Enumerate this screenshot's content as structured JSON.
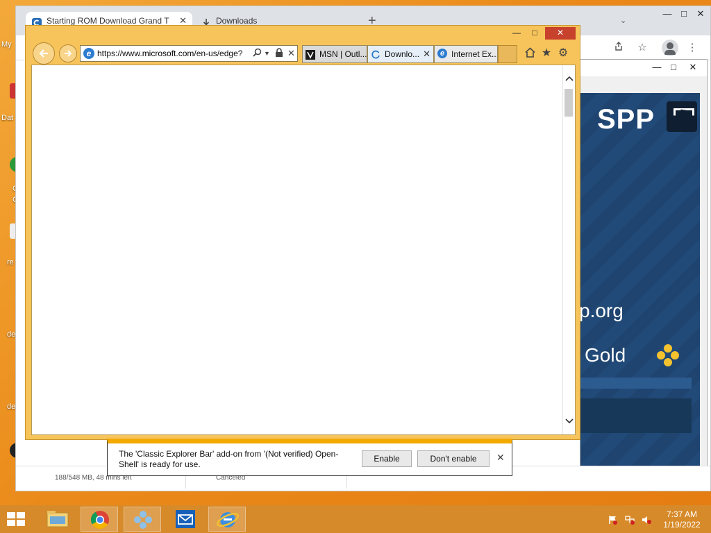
{
  "desktop": {
    "labels": [
      "My",
      "Dat",
      "C",
      "C",
      "re",
      "de",
      "de"
    ]
  },
  "chrome": {
    "tabs": [
      {
        "title": "Starting ROM Download Grand T",
        "close": "✕"
      },
      {
        "title": "Downloads",
        "close": ""
      }
    ],
    "new_tab": "+",
    "caret": "⌄",
    "win": {
      "min": "—",
      "max": "□",
      "close": "✕"
    },
    "ppsspp_win": {
      "min": "—",
      "max": "□",
      "close": "✕"
    },
    "ppsspp": {
      "logo": "SPP",
      "org": "p.org",
      "gold": "Gold"
    },
    "shelf": {
      "size": "188/548 MB, 48 mins left",
      "status": "Canceled"
    }
  },
  "ie": {
    "win": {
      "min": "—",
      "max": "□",
      "close": "✕"
    },
    "address": {
      "url_prefix": "https://www.",
      "url_domain": "microsoft.com",
      "url_rest": "/en-us/edge?"
    },
    "tabs": [
      {
        "title": "MSN | Outl...",
        "close": ""
      },
      {
        "title": "Downlo...",
        "close": "✕"
      },
      {
        "title": "Internet Ex...",
        "close": ""
      }
    ],
    "notification": {
      "message": "The 'Classic Explorer Bar' add-on from '(Not verified) Open-Shell' is ready for use.",
      "enable_label": "Enable",
      "dont_enable_label": "Don't enable",
      "close": "✕"
    }
  },
  "taskbar": {
    "time": "7:37 AM",
    "date": "1/19/2022"
  },
  "colors": {
    "ie_frame": "#f6c45a",
    "notification_accent": "#f2a900",
    "close_red": "#c8412d",
    "taskbar": "#d78a2a"
  }
}
